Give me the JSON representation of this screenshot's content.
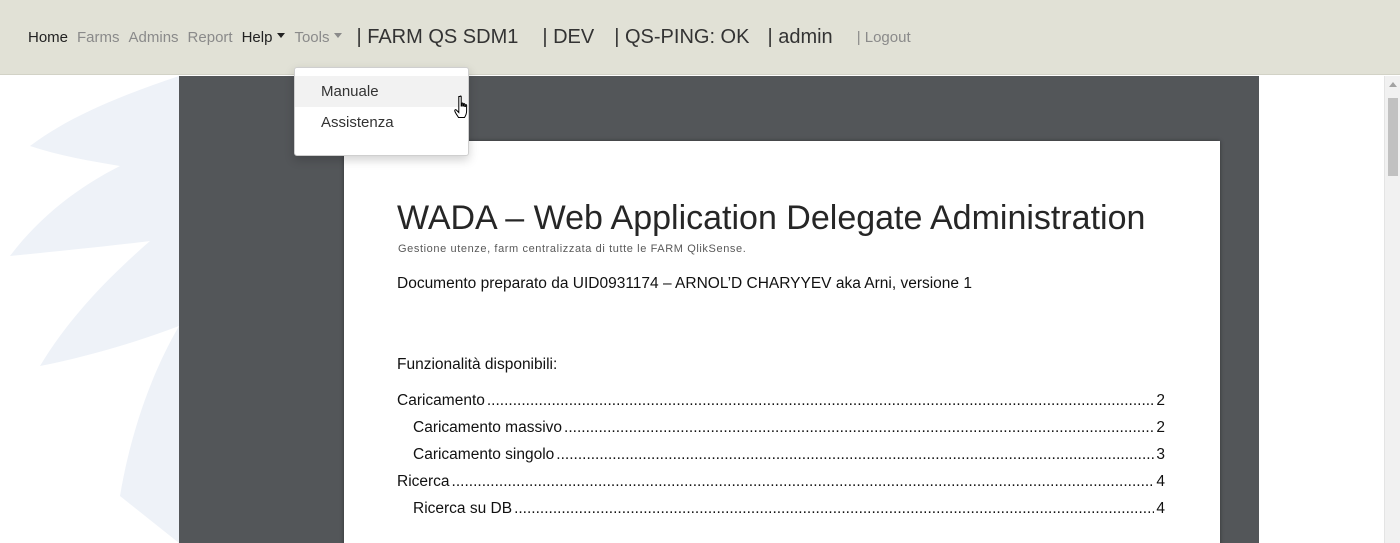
{
  "navbar": {
    "links": [
      {
        "label": "Home",
        "style": "dark"
      },
      {
        "label": "Farms",
        "style": "light"
      },
      {
        "label": "Admins",
        "style": "light"
      },
      {
        "label": "Report",
        "style": "light"
      }
    ],
    "help_label": "Help",
    "tools_label": "Tools",
    "farm": "| FARM QS SDM1",
    "env": "| DEV",
    "ping": "| QS-PING: OK",
    "user": "| admin",
    "logout": "| Logout",
    "background_color": "#e1e1d6"
  },
  "help_menu": {
    "items": [
      {
        "label": "Manuale",
        "hovered": true
      },
      {
        "label": "Assistenza",
        "hovered": false
      }
    ]
  },
  "document": {
    "title": "WADA – Web Application Delegate Administration",
    "subtitle": "Gestione utenze, farm centralizzata di tutte le FARM QlikSense.",
    "author_line": "Documento preparato da UID0931174 – ARNOL’D CHARYYEV aka Arni, versione 1",
    "toc_heading": "Funzionalità disponibili:",
    "toc": [
      {
        "label": "Caricamento",
        "page": "2",
        "level": 1
      },
      {
        "label": "Caricamento massivo",
        "page": "2",
        "level": 2
      },
      {
        "label": "Caricamento singolo",
        "page": "3",
        "level": 2
      },
      {
        "label": "Ricerca",
        "page": "4",
        "level": 1
      },
      {
        "label": "Ricerca su DB",
        "page": "4",
        "level": 2
      }
    ]
  },
  "icons": {
    "cursor": "hand-pointer-icon",
    "scroll_up": "chevron-up-icon"
  },
  "colors": {
    "viewer_bg": "#535659",
    "page_bg": "#ffffff"
  }
}
